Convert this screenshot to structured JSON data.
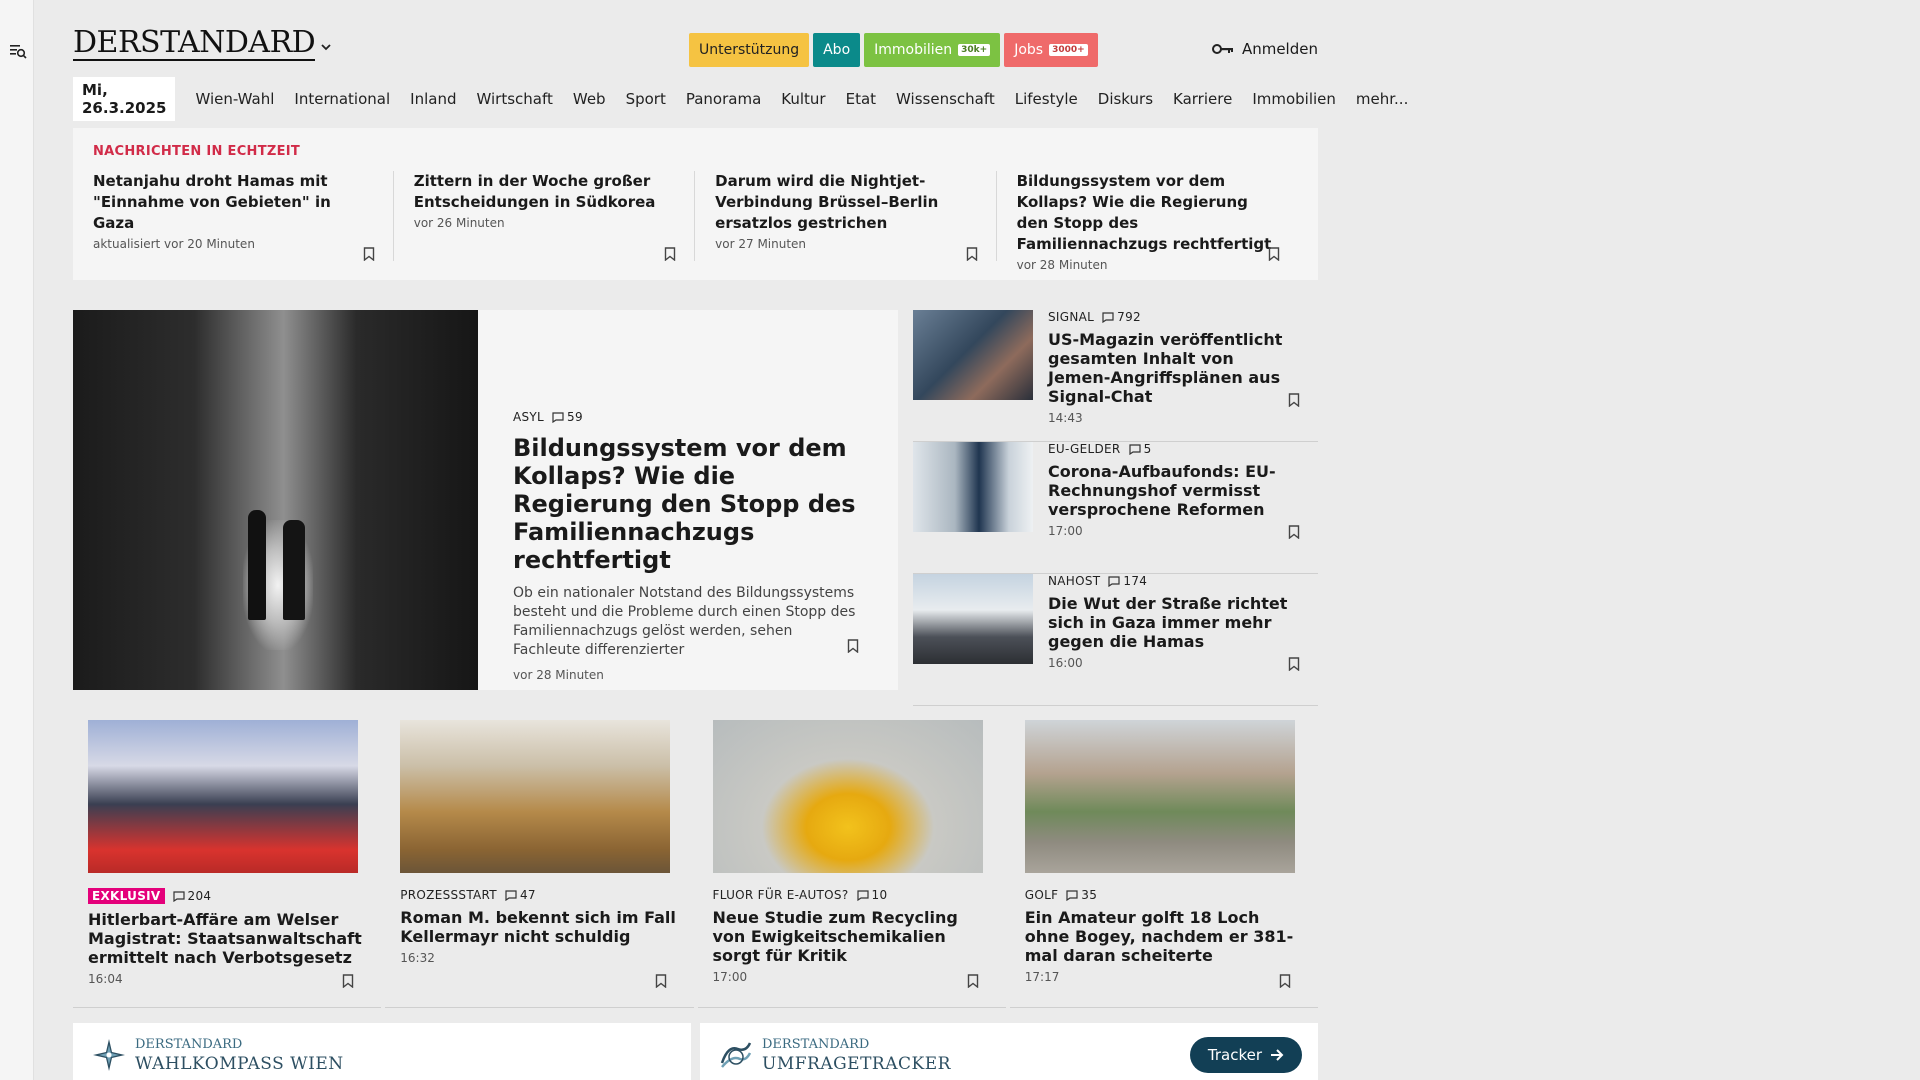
{
  "header": {
    "logo": "DERSTANDARD",
    "buttons": {
      "support": "Unterstützung",
      "abo": "Abo",
      "immobilien": "Immobilien",
      "immobilien_badge": "30k+",
      "jobs": "Jobs",
      "jobs_badge": "3000+"
    },
    "login": "Anmelden"
  },
  "nav": {
    "date": "Mi, 26.3.2025",
    "items": [
      "Wien-Wahl",
      "International",
      "Inland",
      "Wirtschaft",
      "Web",
      "Sport",
      "Panorama",
      "Kultur",
      "Etat",
      "Wissenschaft",
      "Lifestyle",
      "Diskurs",
      "Karriere",
      "Immobilien",
      "mehr..."
    ]
  },
  "ticker": {
    "label": "NACHRICHTEN IN ECHTZEIT",
    "items": [
      {
        "title": "Netanjahu droht Hamas mit \"Einnahme von Gebieten\" in Gaza",
        "time": "aktualisiert vor 20 Minuten"
      },
      {
        "title": "Zittern in der Woche großer Entscheidungen in Südkorea",
        "time": "vor 26 Minuten"
      },
      {
        "title": "Darum wird die Nightjet-Verbindung Brüssel–Berlin ersatzlos gestrichen",
        "time": "vor 27 Minuten"
      },
      {
        "title": "Bildungssystem vor dem Kollaps? Wie die Regierung den Stopp des Familiennachzugs rechtfertigt",
        "time": "vor 28 Minuten"
      }
    ]
  },
  "lead": {
    "kicker": "ASYL",
    "comments": "59",
    "title": "Bildungssystem vor dem Kollaps? Wie die Regierung den Stopp des Familiennachzugs rechtfertigt",
    "teaser": "Ob ein nationaler Notstand des Bildungssystems besteht und die Probleme durch einen Stopp des Familiennachzugs gelöst werden, sehen Fachleute differenzierter",
    "time": "vor 28 Minuten"
  },
  "side": [
    {
      "kicker": "SIGNAL",
      "comments": "792",
      "title": "US-Magazin veröffentlicht gesamten Inhalt von Jemen-Angriffsplänen aus Signal-Chat",
      "time": "14:43"
    },
    {
      "kicker": "EU-GELDER",
      "comments": "5",
      "title": "Corona-Aufbaufonds: EU-Rechnungshof vermisst versprochene Reformen",
      "time": "17:00"
    },
    {
      "kicker": "NAHOST",
      "comments": "174",
      "title": "Die Wut der Straße richtet sich in Gaza immer mehr gegen die Hamas",
      "time": "16:00"
    }
  ],
  "grid": [
    {
      "kicker": "EXKLUSIV",
      "comments": "204",
      "title": "Hitlerbart-Affäre am Welser Magistrat: Staatsanwaltschaft ermittelt nach Verbotsgesetz",
      "time": "16:04"
    },
    {
      "kicker": "PROZESSSTART",
      "comments": "47",
      "title": "Roman M. bekennt sich im Fall Kellermayr nicht schuldig",
      "time": "16:32"
    },
    {
      "kicker": "FLUOR FÜR E-AUTOS?",
      "comments": "10",
      "title": "Neue Studie zum Recycling von Ewigkeitschemikalien sorgt für Kritik",
      "time": "17:00"
    },
    {
      "kicker": "GOLF",
      "comments": "35",
      "title": "Ein Amateur golft 18 Loch ohne Bogey, nachdem er 381-mal daran scheiterte",
      "time": "17:17"
    }
  ],
  "widgets": [
    {
      "small": "DERSTANDARD",
      "big": "WAHLKOMPASS WIEN"
    },
    {
      "small": "DERSTANDARD",
      "big": "UMFRAGETRACKER",
      "button": "Tracker"
    }
  ]
}
